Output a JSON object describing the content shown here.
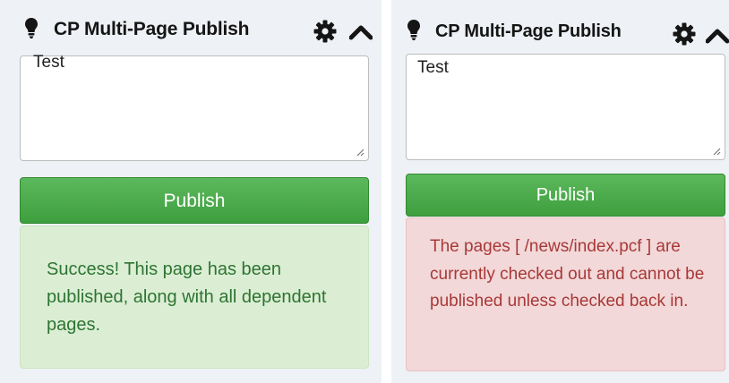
{
  "left_panel": {
    "header": {
      "title": "CP Multi-Page Publish"
    },
    "comment": {
      "value": "Test"
    },
    "publish_label": "Publish",
    "alert": {
      "type": "success",
      "message": "Success! This page has been published, along with all dependent pages."
    }
  },
  "right_panel": {
    "header": {
      "title": "CP Multi-Page Publish"
    },
    "comment": {
      "value": "Test"
    },
    "publish_label": "Publish",
    "alert": {
      "type": "error",
      "message": "The pages [ /news/index.pcf ] are currently checked out and cannot be published unless checked back in."
    }
  },
  "icons": {
    "header_left": "lightbulb-icon",
    "header_right": [
      "gear-icon",
      "chevron-up-icon"
    ]
  },
  "colors": {
    "panel_bg": "#eef1f5",
    "publish_green": "#4cae4c",
    "success_bg": "#dbeed4",
    "success_text": "#2e7432",
    "error_bg": "#f2d8d8",
    "error_text": "#a83838"
  }
}
